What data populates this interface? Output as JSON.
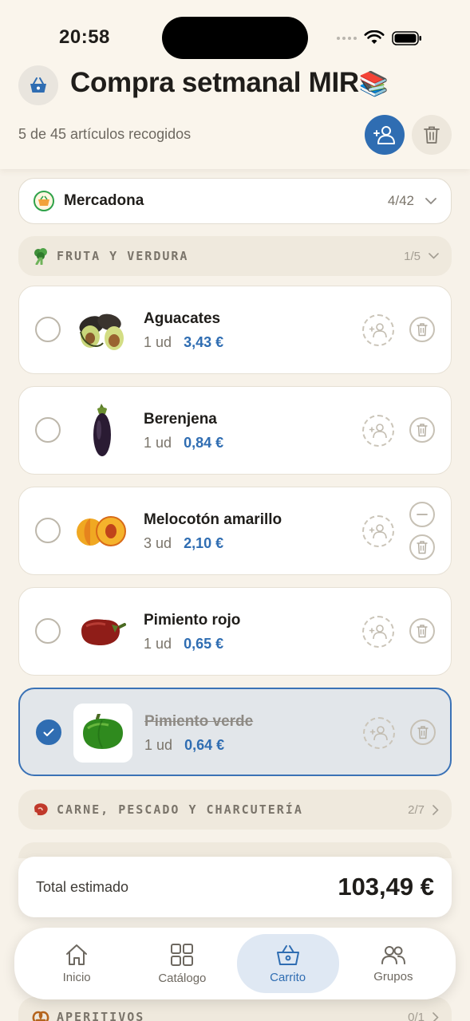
{
  "status": {
    "time": "20:58"
  },
  "header": {
    "title": "Compra setmanal MIR",
    "title_emoji": "📚",
    "subtitle": "5 de 45 artículos recogidos"
  },
  "store": {
    "name": "Mercadona",
    "count": "4/42"
  },
  "categories": [
    {
      "name": "FRUTA Y VERDURA",
      "count": "1/5",
      "icon": "broccoli-icon"
    },
    {
      "name": "CARNE, PESCADO Y CHARCUTERÍA",
      "count": "2/7",
      "icon": "meat-icon"
    },
    {
      "name": "APERITIVOS",
      "count": "0/1",
      "icon": "pretzel-icon"
    }
  ],
  "items": [
    {
      "name": "Aguacates",
      "qty": "1 ud",
      "price": "3,43 €",
      "checked": false
    },
    {
      "name": "Berenjena",
      "qty": "1 ud",
      "price": "0,84 €",
      "checked": false
    },
    {
      "name": "Melocotón amarillo",
      "qty": "3 ud",
      "price": "2,10 €",
      "checked": false
    },
    {
      "name": "Pimiento rojo",
      "qty": "1 ud",
      "price": "0,65 €",
      "checked": false
    },
    {
      "name": "Pimiento verde",
      "qty": "1 ud",
      "price": "0,64 €",
      "checked": true
    }
  ],
  "total": {
    "label": "Total estimado",
    "value": "103,49 €"
  },
  "tabs": [
    {
      "label": "Inicio",
      "icon": "home-icon"
    },
    {
      "label": "Catálogo",
      "icon": "grid-icon"
    },
    {
      "label": "Carrito",
      "icon": "basket-icon",
      "active": true
    },
    {
      "label": "Grupos",
      "icon": "users-icon"
    }
  ],
  "colors": {
    "accent": "#2f6db2",
    "background": "#f7f2e9"
  }
}
